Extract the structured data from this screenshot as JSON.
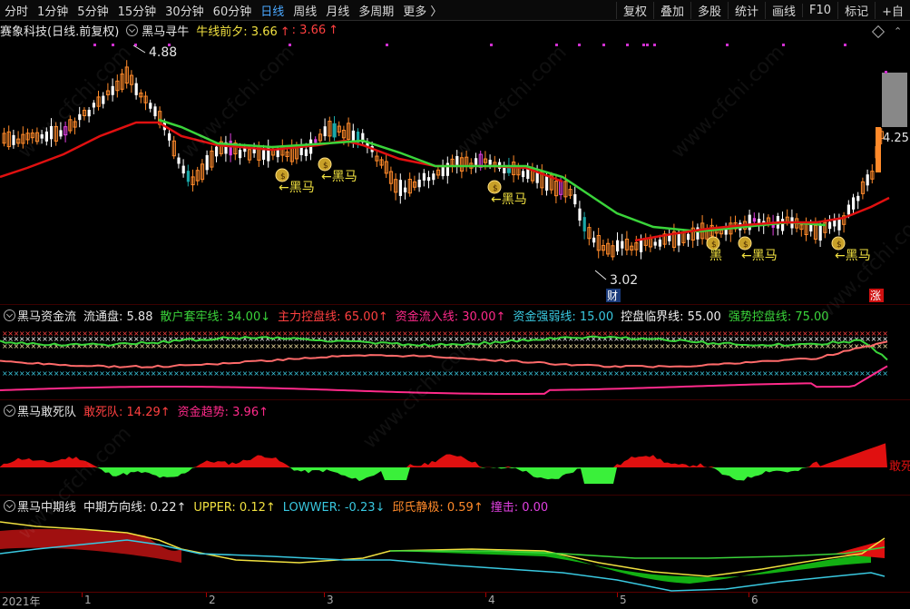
{
  "toolbar": {
    "left": [
      "分时",
      "1分钟",
      "5分钟",
      "15分钟",
      "30分钟",
      "60分钟",
      "日线",
      "周线",
      "月线",
      "多周期",
      "更多 〉"
    ],
    "active": "日线",
    "right": [
      "复权",
      "叠加",
      "多股",
      "统计",
      "画线",
      "F10",
      "标记",
      "+自"
    ]
  },
  "main": {
    "stock": "赛象科技(日线.前复权)",
    "indicator": "黑马寻牛",
    "niu_label": "牛线前夕: 3.66",
    "niu_arrow": "↑",
    "niu_extra": ": 3.66",
    "niu_extra_arrow": "↑",
    "high_label": "4.88",
    "low_label": "3.02",
    "price_label": "4.25",
    "heima": "←黑马",
    "heima_short": "黑",
    "cai": "财",
    "zhang": "涨"
  },
  "panel2": {
    "title": "黑马资金流",
    "items": [
      {
        "text": "流通盘: 5.88",
        "color": "#e6e6e6"
      },
      {
        "text": "散户套牢线: 34.00↓",
        "color": "#3ad43a"
      },
      {
        "text": "主力控盘线: 65.00↑",
        "color": "#ff4040"
      },
      {
        "text": "资金流入线: 30.00↑",
        "color": "#ff2a8a"
      },
      {
        "text": "资金强弱线: 15.00",
        "color": "#39c8e0"
      },
      {
        "text": "控盘临界线: 55.00",
        "color": "#f0f0f0"
      },
      {
        "text": "强势控盘线: 75.00",
        "color": "#3ad43a"
      }
    ]
  },
  "panel3": {
    "title": "黑马敢死队",
    "items": [
      {
        "text": "敢死队: 14.29↑",
        "color": "#ff4040"
      },
      {
        "text": "资金趋势: 3.96↑",
        "color": "#ff2a8a"
      }
    ],
    "right_label": "敢死"
  },
  "panel4": {
    "title": "黑马中期线",
    "items": [
      {
        "text": "中期方向线: 0.22↑",
        "color": "#e6e6e6"
      },
      {
        "text": "UPPER: 0.12↑",
        "color": "#f0e040"
      },
      {
        "text": "LOWWER: -0.23↓",
        "color": "#39c8e0"
      },
      {
        "text": "邱氏静极: 0.59↑",
        "color": "#ff8a2a"
      },
      {
        "text": "撞击: 0.00",
        "color": "#e040e0"
      }
    ]
  },
  "axis": {
    "labels": [
      {
        "text": "2021年"
      },
      {
        "text": "1"
      },
      {
        "text": "2"
      },
      {
        "text": "3"
      },
      {
        "text": "4"
      },
      {
        "text": "5"
      },
      {
        "text": "6"
      }
    ]
  },
  "watermark": "www.cfchi.com",
  "colors": {
    "up": "#ff8a2a",
    "down": "#ffffff",
    "ma_red": "#e01010",
    "ma_green": "#3ad43a",
    "accent": "#4aa8ff"
  }
}
